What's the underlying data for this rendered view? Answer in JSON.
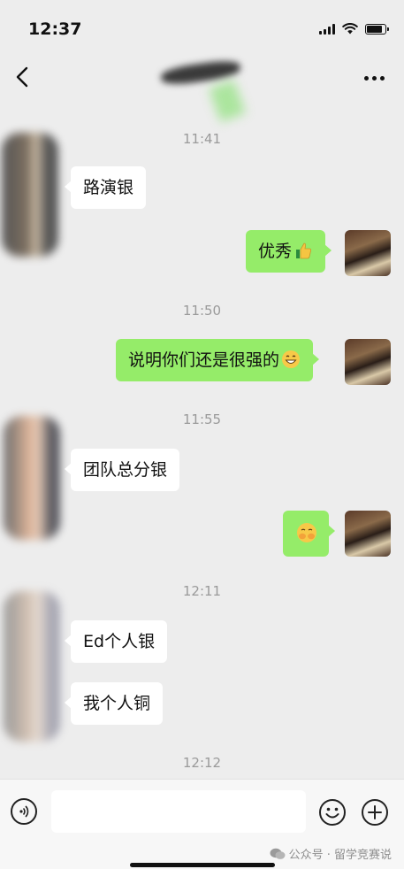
{
  "status_bar": {
    "time": "12:37",
    "battery_level": 0.85
  },
  "header": {
    "more_label": "..."
  },
  "messages": [
    {
      "type": "time",
      "text": "11:41"
    },
    {
      "type": "incoming",
      "text": "路演银"
    },
    {
      "type": "outgoing",
      "text": "优秀",
      "emoji": "thumbs-up"
    },
    {
      "type": "time",
      "text": "11:50"
    },
    {
      "type": "outgoing",
      "text": "说明你们还是很强的",
      "emoji": "grinning-face"
    },
    {
      "type": "time",
      "text": "11:55"
    },
    {
      "type": "incoming",
      "text": "团队总分银"
    },
    {
      "type": "outgoing",
      "text": "",
      "emoji": "shy-face"
    },
    {
      "type": "time",
      "text": "12:11"
    },
    {
      "type": "incoming",
      "text": "Ed个人银"
    },
    {
      "type": "incoming",
      "text": "我个人铜"
    },
    {
      "type": "time",
      "text": "12:12"
    }
  ],
  "input": {
    "value": "",
    "placeholder": ""
  },
  "watermark": {
    "text": "公众号 · 留学竞赛说"
  },
  "colors": {
    "outgoing_bubble": "#95ec69",
    "incoming_bubble": "#ffffff",
    "background": "#ededed"
  }
}
